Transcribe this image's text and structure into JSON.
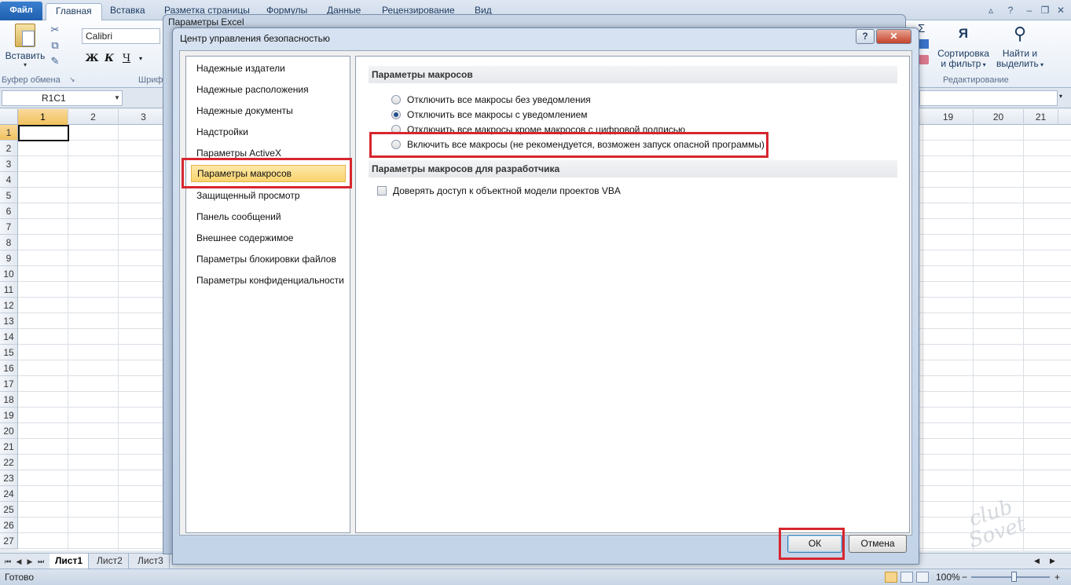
{
  "ribbon": {
    "file_tab": "Файл",
    "tabs": [
      "Главная",
      "Вставка",
      "Разметка страницы",
      "Формулы",
      "Данные",
      "Рецензирование",
      "Вид"
    ],
    "paste_label": "Вставить",
    "clipboard_group": "Буфер обмена",
    "font_name": "Calibri",
    "font_group_partial": "Шриф",
    "bold": "Ж",
    "italic": "К",
    "underline": "Ч",
    "sort_label_1": "Сортировка",
    "sort_label_2": "и фильтр",
    "find_label_1": "Найти и",
    "find_label_2": "выделить",
    "editing_group": "Редактирование",
    "sigma": "Σ"
  },
  "formula_bar": {
    "name_box": "R1C1"
  },
  "grid": {
    "columns_left": [
      "1",
      "2",
      "3"
    ],
    "columns_right": [
      "19",
      "20",
      "21"
    ],
    "rows": [
      "1",
      "2",
      "3",
      "4",
      "5",
      "6",
      "7",
      "8",
      "9",
      "10",
      "11",
      "12",
      "13",
      "14",
      "15",
      "16",
      "17",
      "18",
      "19",
      "20",
      "21",
      "22",
      "23",
      "24",
      "25",
      "26",
      "27"
    ]
  },
  "sheets": {
    "tabs": [
      "Лист1",
      "Лист2",
      "Лист3"
    ]
  },
  "status": {
    "ready": "Готово",
    "zoom": "100%"
  },
  "excel_options": {
    "title": "Параметры Excel"
  },
  "dialog": {
    "title": "Центр управления безопасностью",
    "help": "?",
    "close": "✕",
    "nav": [
      "Надежные издатели",
      "Надежные расположения",
      "Надежные документы",
      "Надстройки",
      "Параметры ActiveX",
      "Параметры макросов",
      "Защищенный просмотр",
      "Панель сообщений",
      "Внешнее содержимое",
      "Параметры блокировки файлов",
      "Параметры конфиденциальности"
    ],
    "selected_nav_index": 5,
    "macro_section": "Параметры макросов",
    "macro_options": [
      "Отключить все макросы без уведомления",
      "Отключить все макросы с уведомлением",
      "Отключить все макросы кроме макросов с цифровой подписью",
      "Включить все макросы (не рекомендуется, возможен запуск опасной программы)"
    ],
    "selected_macro_option": 1,
    "dev_section": "Параметры макросов для разработчика",
    "vba_checkbox": "Доверять доступ к объектной модели проектов VBA",
    "ok": "ОК",
    "cancel": "Отмена"
  },
  "watermark": {
    "line1": "club",
    "line2": "Sovet"
  },
  "colors": {
    "highlight": "#d7262e",
    "selection": "#f9d36d",
    "accent": "#1f5fae"
  }
}
